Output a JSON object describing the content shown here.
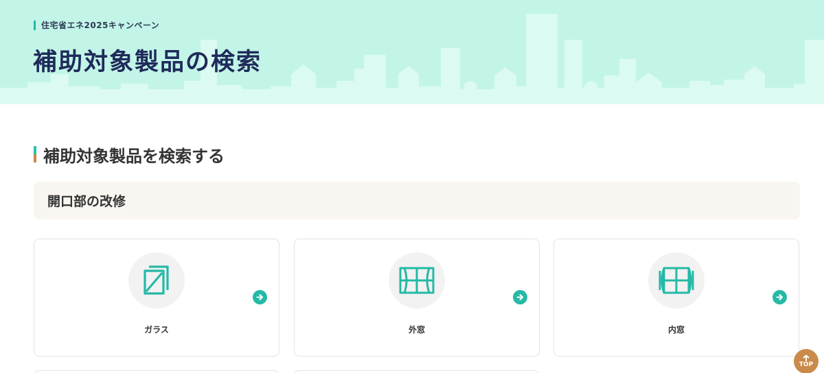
{
  "hero": {
    "eyebrow": "住宅省エネ2025キャンペーン",
    "title": "補助対象製品の検索"
  },
  "section": {
    "title": "補助対象製品を検索する"
  },
  "category": {
    "title": "開口部の改修"
  },
  "products": [
    {
      "label": "ガラス",
      "icon": "glass-icon"
    },
    {
      "label": "外窓",
      "icon": "outer-window-icon"
    },
    {
      "label": "内窓",
      "icon": "inner-window-icon"
    }
  ],
  "top_button": {
    "label": "TOP"
  },
  "colors": {
    "hero_bg": "#c2f5e7",
    "accent_teal": "#25b9a6",
    "accent_brown": "#c98a4b",
    "title_navy": "#1f2a5a",
    "category_bg": "#f9f6f1"
  }
}
